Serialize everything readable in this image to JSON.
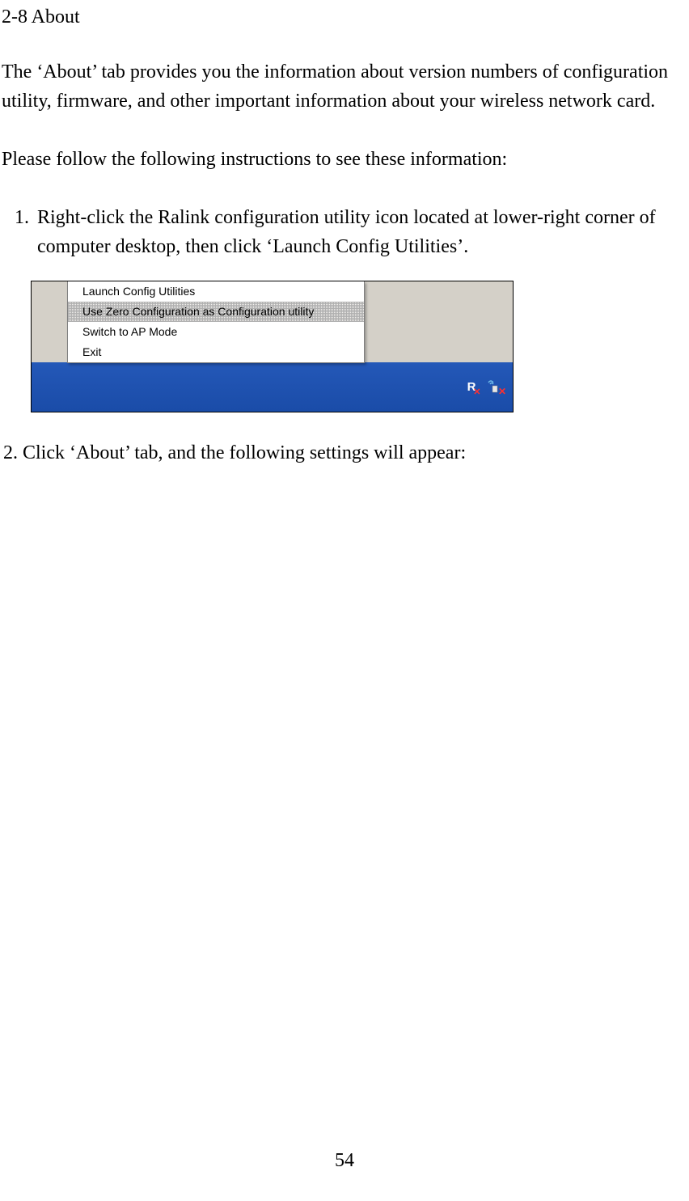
{
  "heading": "2-8 About",
  "paragraph1": "The ‘About’ tab provides you the information about version numbers of configuration utility, firmware, and other important information about your wireless network card.",
  "paragraph2": "Please follow the following instructions to see these information:",
  "step1": "Right-click the Ralink configuration utility icon located at lower-right corner of computer desktop, then click ‘Launch Config Utilities’.",
  "contextMenu": {
    "items": [
      "Launch Config Utilities",
      "Use Zero Configuration as Configuration utility",
      "Switch to AP Mode",
      "Exit"
    ]
  },
  "step2": "2. Click ‘About’ tab, and the following settings will appear:",
  "pageNumber": "54"
}
